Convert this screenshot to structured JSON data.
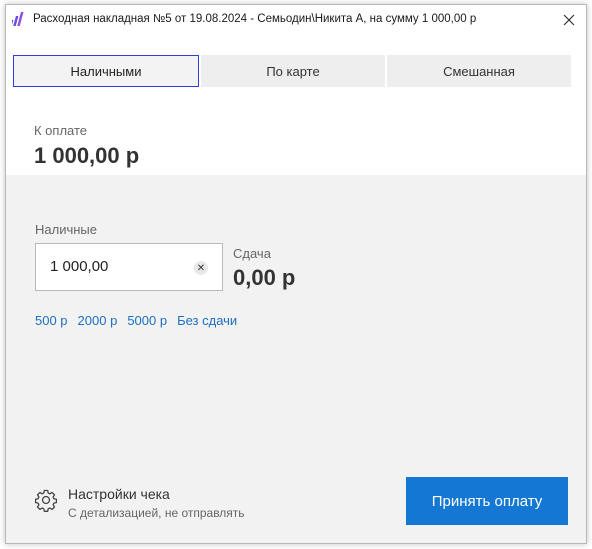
{
  "window": {
    "title": "Расходная накладная №5 от 19.08.2024 - Семьодин\\Никита А, на сумму 1 000,00 р",
    "close_symbol": "✕"
  },
  "tabs": [
    {
      "label": "Наличными",
      "active": true
    },
    {
      "label": "По карте",
      "active": false
    },
    {
      "label": "Смешанная",
      "active": false
    }
  ],
  "due": {
    "label": "К оплате",
    "amount": "1 000,00 р"
  },
  "cash": {
    "label": "Наличные",
    "value": "1 000,00",
    "clear_symbol": "✕"
  },
  "change": {
    "label": "Сдача",
    "amount": "0,00 р"
  },
  "quick_amounts": [
    "500 р",
    "2000 р",
    "5000 р",
    "Без сдачи"
  ],
  "settings": {
    "title": "Настройки чека",
    "subtitle": "С детализацией, не отправлять"
  },
  "pay_button": {
    "label": "Принять оплату"
  },
  "colors": {
    "accent": "#1577d4",
    "link": "#1c6fc2",
    "active_tab_border": "#2d3fd8"
  }
}
